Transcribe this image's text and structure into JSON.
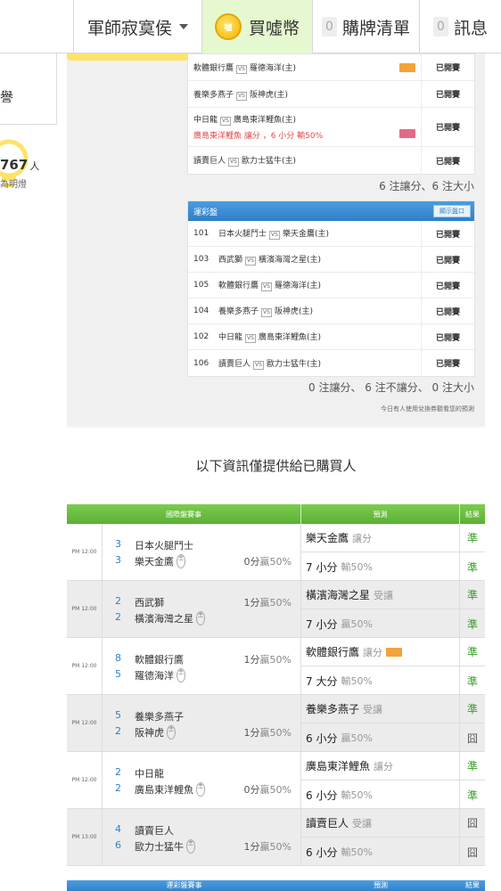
{
  "nav": {
    "user_name": "軍師寂寞侯",
    "buy_label": "買噓幣",
    "coin_text": "噓",
    "cart_count": "0",
    "cart_label": "購牌清單",
    "msg_count": "0",
    "msg_label": "訊息"
  },
  "sidebar": {
    "box1_text": "譽",
    "count": "767",
    "count_unit": "人",
    "hint": "為明燈"
  },
  "upper_list": [
    {
      "home": "軟體銀行鷹",
      "away": "羅德海洋(主)",
      "status": "已開賽",
      "tag": "orange"
    },
    {
      "home": "養樂多燕子",
      "away": "阪神虎(主)",
      "status": "已開賽"
    },
    {
      "home": "中日龍",
      "away": "廣島東洋鯉魚(主)",
      "status": "已開賽",
      "note": "廣島東洋鯉魚  讓分 ，6 小分 輸50%",
      "tag": "pink"
    },
    {
      "home": "讀賣巨人",
      "away": "歐力士猛牛(主)",
      "status": "已開賽"
    }
  ],
  "summary1": "6 注讓分、6 注大小",
  "vs_text": "VS",
  "parlay": {
    "title": "運彩盤",
    "show_button": "顯示盤口",
    "rows": [
      {
        "num": "101",
        "home": "日本火腿鬥士",
        "away": "樂天金鷹(主)",
        "status": "已開賽"
      },
      {
        "num": "103",
        "home": "西武獅",
        "away": "橫濱海灣之星(主)",
        "status": "已開賽"
      },
      {
        "num": "105",
        "home": "軟體銀行鷹",
        "away": "羅德海洋(主)",
        "status": "已開賽"
      },
      {
        "num": "104",
        "home": "養樂多燕子",
        "away": "阪神虎(主)",
        "status": "已開賽"
      },
      {
        "num": "102",
        "home": "中日龍",
        "away": "廣島東洋鯉魚(主)",
        "status": "已開賽"
      },
      {
        "num": "106",
        "home": "讀賣巨人",
        "away": "歐力士猛牛(主)",
        "status": "已開賽"
      }
    ]
  },
  "summary2": "0 注讓分、 6 注不讓分、 0 注大小",
  "today_note": "今日有人使用兌換券觀看您的預測",
  "section_title": "以下資訊僅提供給已購買人",
  "table": {
    "headers": [
      "國際盤賽事",
      "預測",
      "結果"
    ],
    "home_mark": "主",
    "games": [
      {
        "time": "PM 12:00",
        "t1": "日本火腿鬥士",
        "t1n": "3",
        "t2": "樂天金鷹",
        "t2n": "3",
        "odds_a": "0分",
        "odds_b": "贏50%",
        "shade": false,
        "p1": "樂天金鷹",
        "p1s": "讓分",
        "p2": "7 小分",
        "p2s": "輸50%",
        "r1": "準",
        "r2": "準",
        "odds_row": 2
      },
      {
        "time": "PM 12:00",
        "t1": "西武獅",
        "t1n": "2",
        "t2": "橫濱海灣之星",
        "t2n": "2",
        "odds_a": "1分",
        "odds_b": "贏50%",
        "shade": true,
        "p1": "橫濱海灣之星",
        "p1s": "受讓",
        "p2": "7 小分",
        "p2s": "贏50%",
        "r1": "準",
        "r2": "準",
        "odds_row": 1
      },
      {
        "time": "PM 12:00",
        "t1": "軟體銀行鷹",
        "t1n": "8",
        "t2": "羅德海洋",
        "t2n": "5",
        "odds_a": "1分",
        "odds_b": "贏50%",
        "shade": false,
        "p1": "軟體銀行鷹",
        "p1s": "讓分",
        "p2": "7 大分",
        "p2s": "輸50%",
        "r1": "準",
        "r2": "準",
        "odds_row": 1,
        "tag": true
      },
      {
        "time": "PM 12:00",
        "t1": "養樂多燕子",
        "t1n": "5",
        "t2": "阪神虎",
        "t2n": "2",
        "odds_a": "1分",
        "odds_b": "贏50%",
        "shade": true,
        "p1": "養樂多燕子",
        "p1s": "受讓",
        "p2": "6 小分",
        "p2s": "贏50%",
        "r1": "準",
        "r2": "囧",
        "odds_row": 2
      },
      {
        "time": "PM 12:00",
        "t1": "中日龍",
        "t1n": "2",
        "t2": "廣島東洋鯉魚",
        "t2n": "2",
        "odds_a": "0分",
        "odds_b": "贏50%",
        "shade": false,
        "p1": "廣島東洋鯉魚",
        "p1s": "讓分",
        "p2": "6 小分",
        "p2s": "輸50%",
        "r1": "準",
        "r2": "準",
        "odds_row": 2
      },
      {
        "time": "PM 13:00",
        "t1": "讀賣巨人",
        "t1n": "4",
        "t2": "歐力士猛牛",
        "t2n": "6",
        "odds_a": "1分",
        "odds_b": "贏50%",
        "shade": true,
        "p1": "讀賣巨人",
        "p1s": "受讓",
        "p2": "6 小分",
        "p2s": "輸50%",
        "r1": "囧",
        "r2": "囧",
        "odds_row": 2
      }
    ]
  },
  "next_table_headers": [
    "運彩盤賽事",
    "預測",
    "結果"
  ]
}
